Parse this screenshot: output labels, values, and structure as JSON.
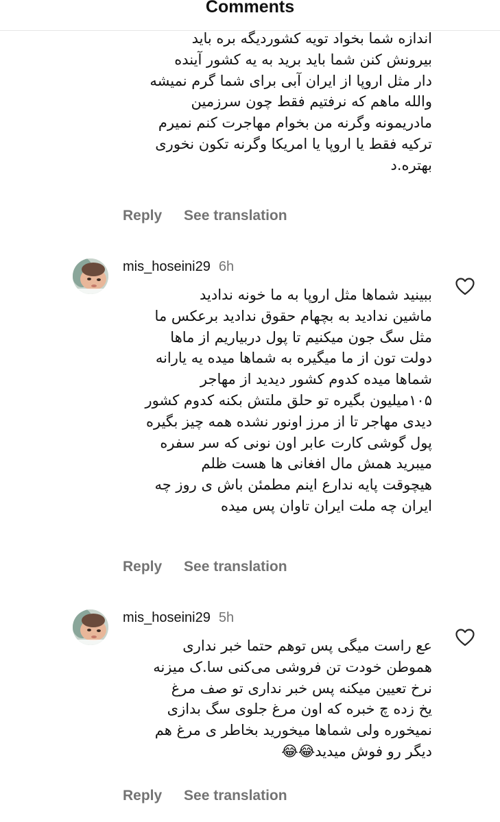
{
  "header": {
    "title": "Comments"
  },
  "comments": [
    {
      "lines": [
        "اندازه شما بخواد تویه کشوردیگه  بره باید",
        "بیرونش کنن  شما باید برید به یه کشور آینده",
        "دار مثل اروپا از ایران آبی برای شما گرم نمیشه",
        "والله ماهم که نرفتیم فقط چون سرزمین",
        "مادریمونه وگرنه من بخوام مهاجرت کنم نمیرم",
        "ترکیه فقط یا اروپا یا امریکا وگرنه تکون نخوری",
        "بهتره.د"
      ],
      "reply_label": "Reply",
      "translate_label": "See translation"
    },
    {
      "username": "mis_hoseini29",
      "time": "6h",
      "lines": [
        "ببینید شماها مثل اروپا به ما خونه ندادید",
        "ماشین ندادید به بچهام حقوق ندادید برعکس ما",
        "مثل سگ جون میکنیم تا پول دربیاریم از ماها",
        "دولت تون از ما میگیره به شماها میده یه یارانه",
        "شماها میده کدوم کشور دیدید از مهاجر",
        "۱۰۵میلیون بگیره تو حلق ملتش بکنه کدوم کشور",
        "دیدی مهاجر تا از مرز اونور نشده همه چیز بگیره",
        "پول گوشی کارت عابر اون نونی که سر سفره",
        "میبرید همش مال افغانی ها هست ظلم",
        "هیچوقت پایه ندارع اینم مطمئن باش ی روز چه",
        "ایران چه ملت ایران تاوان پس میده"
      ],
      "reply_label": "Reply",
      "translate_label": "See translation"
    },
    {
      "username": "mis_hoseini29",
      "time": "5h",
      "lines": [
        "عع راست میگی پس توهم حتما خبر نداری",
        "هموطن خودت تن فروشی می‌کنی سا.ک میزنه",
        "نرخ تعیین میکنه پس خبر نداری تو صف مرغ",
        "یخ زده چ خبره که اون مرغ جلوی سگ بدازی",
        "نمیخوره ولی شماها میخورید بخاطر ی مرغ هم",
        "دیگر رو فوش میدید😂😂"
      ],
      "reply_label": "Reply",
      "translate_label": "See translation"
    }
  ],
  "icons": {
    "like": "heart-outline-icon",
    "emoji": "face-with-tears-of-joy-icon"
  },
  "colors": {
    "text": "#111111",
    "secondary": "#737373",
    "divider": "#e6e6e6",
    "background": "#ffffff"
  }
}
